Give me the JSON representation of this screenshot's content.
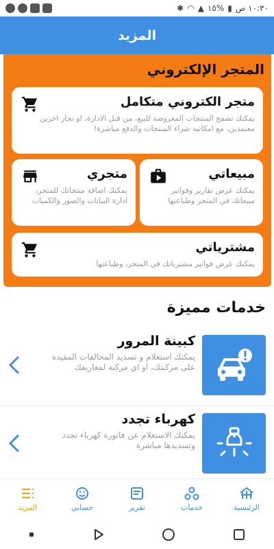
{
  "status_bar": {
    "time": "١٠:٣٠ ص",
    "battery": "١٥%"
  },
  "app_bar": {
    "title": "المزيد"
  },
  "store": {
    "title": "المتجر الإلكتروني",
    "cards": {
      "full": {
        "title": "متجر الكتروني متكامل",
        "desc": "يمكنك تصفح المنتجات المعروضة للبيع، من قبل الادارة، او تجار اخرين معتمدين، مع امكانية شراء المنتجات والدفع مباشرة!",
        "icon": "cart-icon"
      },
      "sales": {
        "title": "مبيعاتي",
        "desc": "يمكنك عرض تقارير وفواتير مبيعاتك في المتجر وطباعتها",
        "icon": "briefcase-icon"
      },
      "mystore": {
        "title": "متجري",
        "desc": "يمكنك اضافة منتجاتك للمتجر، ادارة البيانات والصور والكميات",
        "icon": "storefront-icon"
      },
      "purchases": {
        "title": "مشترياتي",
        "desc": "يمكنك عرض فواتير مشترياتك في المتجر، وطباعتها",
        "icon": "cart-icon"
      }
    }
  },
  "featured": {
    "title": "خدمات مميزة",
    "items": [
      {
        "title": "كبينة المرور",
        "desc": "يمكنك استعلام و تسديد المخالفات المقيدة على مركبتك، او اي مركبة لمعاريفك",
        "icon": "car-alert-icon"
      },
      {
        "title": "كهرباء تجدد",
        "desc": "يمكنك الاستعلام عن فاتورة كهرباء تجدد وتسديدها مباشرة",
        "icon": "lightbulb-icon"
      }
    ]
  },
  "bottom_nav": {
    "items": [
      {
        "label": "الرئيسية",
        "icon": "home-icon"
      },
      {
        "label": "خدمات",
        "icon": "services-icon"
      },
      {
        "label": "تقرير",
        "icon": "report-icon"
      },
      {
        "label": "حسابي",
        "icon": "account-icon"
      },
      {
        "label": "المزيد",
        "icon": "menu-icon"
      }
    ]
  },
  "colors": {
    "primary": "#3f8fe3",
    "accent_orange": "#f57c12",
    "active_nav": "#f0a30a"
  }
}
